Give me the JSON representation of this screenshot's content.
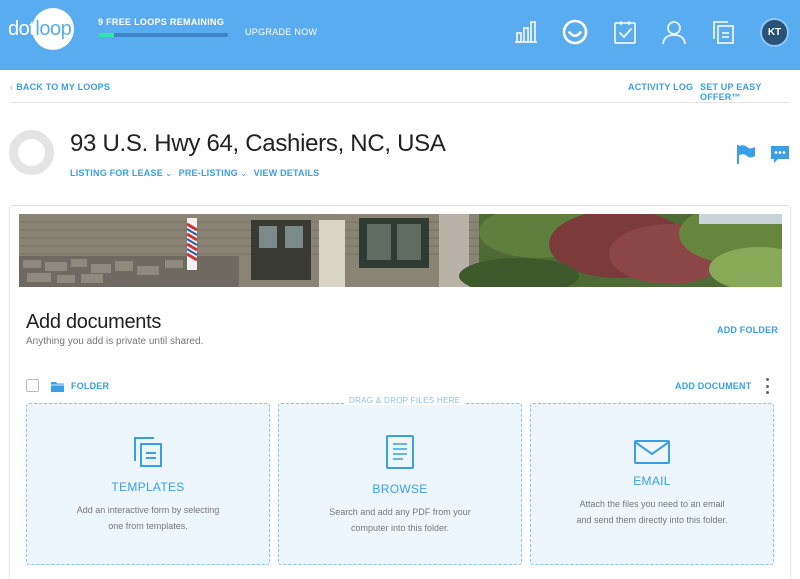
{
  "header": {
    "logo_left": "dot",
    "logo_right": "loop",
    "loops_remaining": "9 FREE LOOPS REMAINING",
    "loops_progress": 0.12,
    "upgrade_label": "UPGRADE NOW",
    "nav_icons": [
      "analytics-icon",
      "loops-icon",
      "tasks-icon",
      "people-icon",
      "templates-icon"
    ],
    "avatar_initials": "KT"
  },
  "subnav": {
    "back_label": "BACK TO MY LOOPS",
    "activity_log": "ACTIVITY LOG",
    "easy_offer": "SET UP EASY OFFER™"
  },
  "property": {
    "title": "93 U.S. Hwy 64, Cashiers, NC, USA",
    "type": "LISTING FOR LEASE",
    "status": "PRE-LISTING",
    "view_details": "VIEW DETAILS"
  },
  "documents": {
    "title": "Add documents",
    "subtitle": "Anything you add is private until shared.",
    "add_folder": "ADD FOLDER",
    "folder_label": "FOLDER",
    "add_document": "ADD DOCUMENT",
    "drag_drop": "DRAG & DROP FILES HERE",
    "tiles": [
      {
        "title": "TEMPLATES",
        "desc_line1": "Add an interactive form by selecting",
        "desc_line2": "one from templates."
      },
      {
        "title": "BROWSE",
        "desc_line1": "Search and add any PDF from your",
        "desc_line2": "computer into this folder."
      },
      {
        "title": "EMAIL",
        "desc_line1": "Attach the files you need to an email",
        "desc_line2": "and send them directly into this folder."
      }
    ]
  },
  "colors": {
    "brand_blue": "#5aacf0",
    "link_blue": "#3a9ee8",
    "progress_green": "#2ee8a8",
    "avatar_bg": "#2a5277"
  }
}
